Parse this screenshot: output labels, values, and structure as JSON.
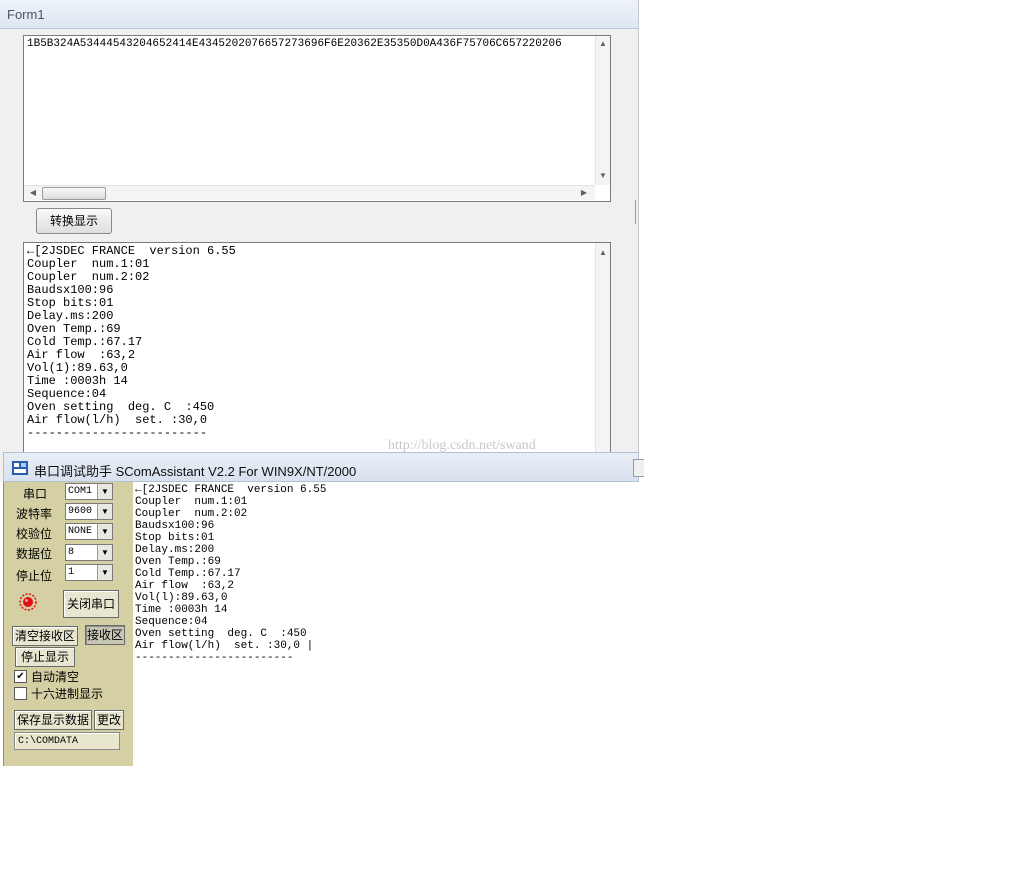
{
  "form1": {
    "title": "Form1",
    "hex_text": "1B5B324A53444543204652414E4345202076657273696F6E20362E35350D0A436F75706C657220206",
    "convert_button": "转换显示",
    "output_lines": "←[2JSDEC FRANCE  version 6.55\nCoupler  num.1:01\nCoupler  num.2:02\nBaudsx100:96\nStop bits:01\nDelay.ms:200\nOven Temp.:69\nCold Temp.:67.17\nAir flow  :63,2\nVol(1):89.63,0\nTime :0003h 14\nSequence:04\nOven setting  deg. C  :450\nAir flow(l/h)  set. :30,0\n-------------------------"
  },
  "scom": {
    "title": "串口调试助手 SComAssistant V2.2 For WIN9X/NT/2000",
    "port_label": "串口",
    "port_value": "COM1",
    "baud_label": "波特率",
    "baud_value": "9600",
    "parity_label": "校验位",
    "parity_value": "NONE",
    "databits_label": "数据位",
    "databits_value": "8",
    "stopbits_label": "停止位",
    "stopbits_value": "1",
    "close_port_button": "关闭串口",
    "clear_recv_button": "清空接收区",
    "recv_area_button": "接收区",
    "stop_display_button": "停止显示",
    "auto_clear_label": "自动清空",
    "auto_clear_checked": "✔",
    "hex_display_label": "十六进制显示",
    "save_data_button": "保存显示数据",
    "change_button": "更改",
    "save_path": "C:\\COMDATA",
    "recv_lines": "←[2JSDEC FRANCE  version 6.55\nCoupler  num.1:01\nCoupler  num.2:02\nBaudsx100:96\nStop bits:01\nDelay.ms:200\nOven Temp.:69\nCold Temp.:67.17\nAir flow  :63,2\nVol(l):89.63,0\nTime :0003h 14\nSequence:04\nOven setting  deg. C  :450\nAir flow(l/h)  set. :30,0 |\n------------------------"
  },
  "watermark": "http://blog.csdn.net/swand",
  "colors": {
    "led_red": "#e01010",
    "panel_bg": "#d4d0a4"
  }
}
